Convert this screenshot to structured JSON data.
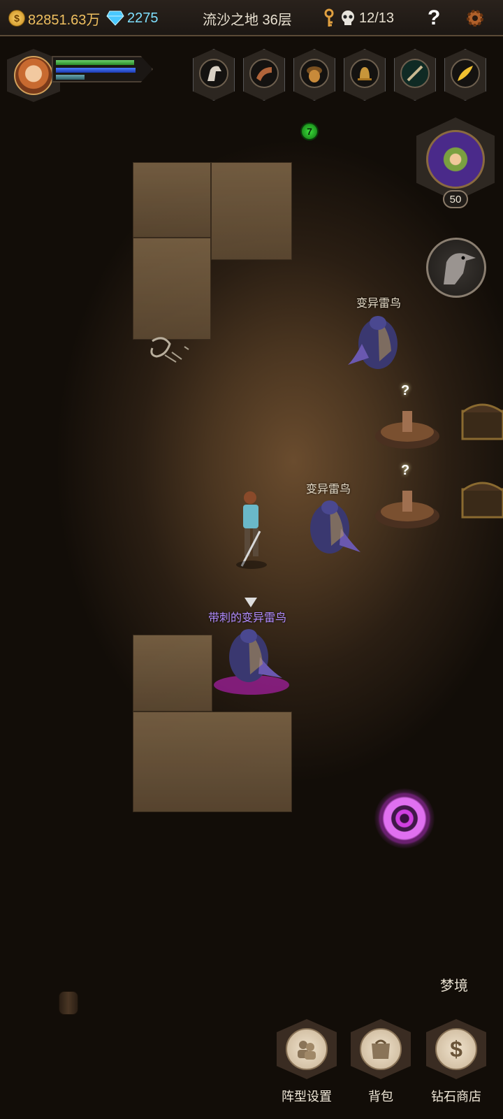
{
  "top_bar": {
    "gold": "82851.63万",
    "gems": "2275",
    "floor": "流沙之地 36层",
    "keys_icon": "key-icon",
    "kills": "12/13",
    "help": "?"
  },
  "colors": {
    "gold": "#f0c060",
    "gem": "#7fe0ff",
    "elite": "#b18cff",
    "portal": "#e070f0"
  },
  "player": {
    "hp_fraction": 0.95,
    "mp_fraction": 0.97,
    "xp_fraction": 0.35
  },
  "item_slots": [
    {
      "name": "horse-head-icon"
    },
    {
      "name": "horn-icon"
    },
    {
      "name": "acorn-icon"
    },
    {
      "name": "bell-icon"
    },
    {
      "name": "flute-icon"
    },
    {
      "name": "feather-icon"
    }
  ],
  "green_badge": "7",
  "companion": {
    "level": "50"
  },
  "enemies": [
    {
      "label": "变异雷鸟"
    },
    {
      "label": "变异雷鸟"
    },
    {
      "label": "带刺的变异雷鸟"
    }
  ],
  "altar_marker": "?",
  "bottom": {
    "dream": "梦境",
    "buttons": [
      {
        "label": "阵型设置",
        "icon": "formation-icon"
      },
      {
        "label": "背包",
        "icon": "backpack-icon"
      },
      {
        "label": "钻石商店",
        "icon": "dollar-icon"
      }
    ]
  }
}
